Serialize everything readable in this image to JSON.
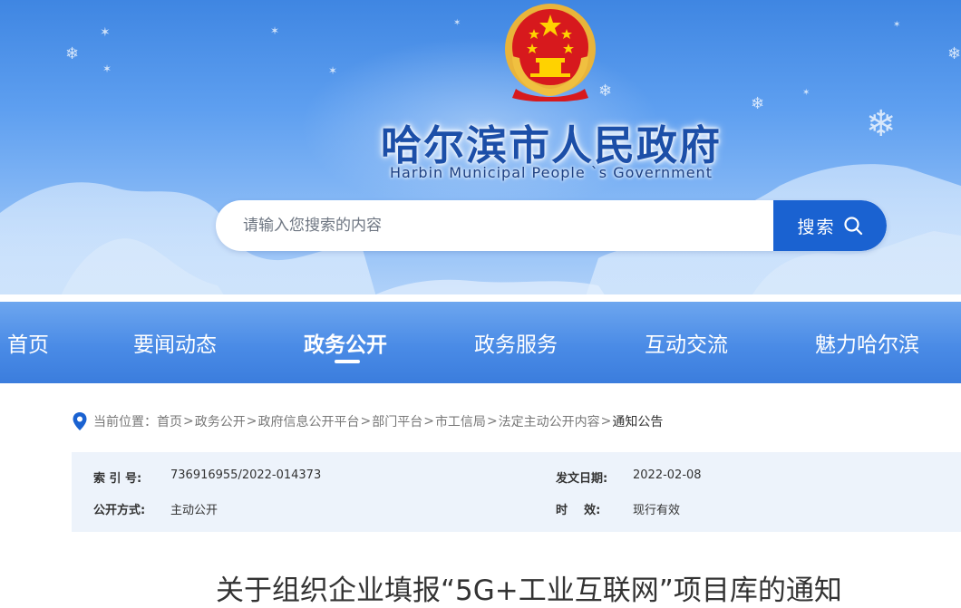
{
  "header": {
    "emblem": "national-emblem",
    "title": "哈尔滨市人民政府",
    "subtitle": "Harbin Municipal People `s Government"
  },
  "search": {
    "placeholder": "请输入您搜索的内容",
    "button_label": "搜索",
    "button_icon": "search-icon"
  },
  "nav": {
    "items": [
      {
        "label": "首页"
      },
      {
        "label": "要闻动态"
      },
      {
        "label": "政务公开",
        "active": true
      },
      {
        "label": "政务服务"
      },
      {
        "label": "互动交流"
      },
      {
        "label": "魅力哈尔滨"
      }
    ]
  },
  "breadcrumb": {
    "icon": "location-pin-icon",
    "prefix": "当前位置：",
    "items": [
      "首页",
      "政务公开",
      "政府信息公开平台",
      "部门平台",
      "市工信局",
      "法定主动公开内容"
    ],
    "current": "通知公告",
    "separator": ">"
  },
  "meta": {
    "index_label": "索 引 号:",
    "index_value": "736916955/2022-014373",
    "date_label": "发文日期:",
    "date_value": "2022-02-08",
    "method_label": "公开方式:",
    "method_value": "主动公开",
    "validity_label": "时    效:",
    "validity_value": "现行有效"
  },
  "article": {
    "title": "关于组织企业填报“5G+工业互联网”项目库的通知"
  },
  "colors": {
    "brand_blue": "#1a62d1",
    "title_blue": "#1c4fa8",
    "nav_blue": "#4a8be6",
    "meta_bg": "#edf3fb"
  }
}
